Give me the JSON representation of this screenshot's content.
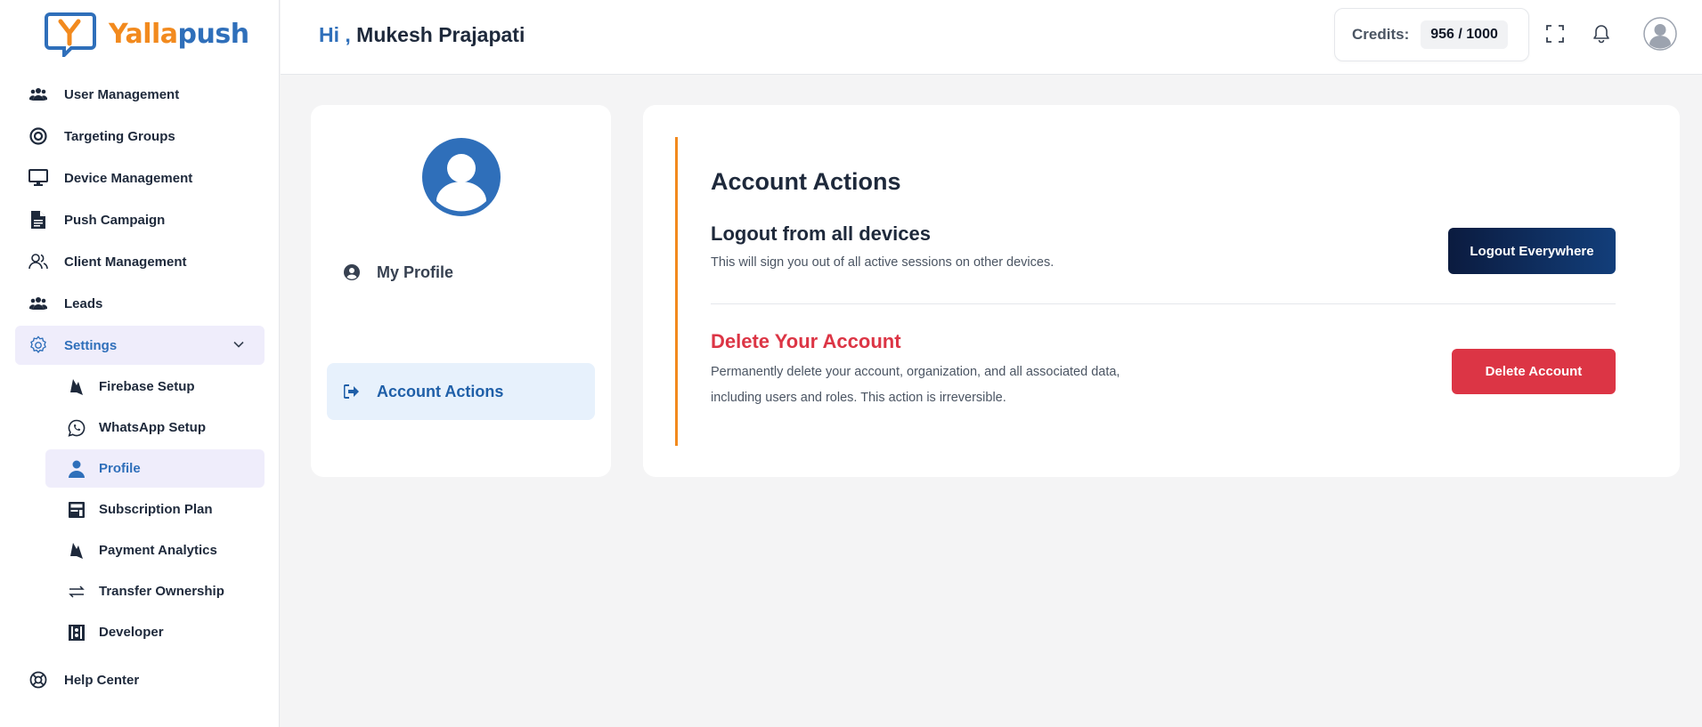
{
  "brand": {
    "name_part1": "Yalla",
    "name_part2": "push"
  },
  "header": {
    "greeting_hi": "Hi ,",
    "user_name": "Mukesh Prajapati",
    "credits_label": "Credits:",
    "credits_value": "956 / 1000"
  },
  "sidebar": {
    "items": [
      {
        "label": "User Management",
        "icon": "users-icon"
      },
      {
        "label": "Targeting Groups",
        "icon": "target-icon"
      },
      {
        "label": "Device Management",
        "icon": "monitor-icon"
      },
      {
        "label": "Push Campaign",
        "icon": "document-icon"
      },
      {
        "label": "Client Management",
        "icon": "user-group-outline-icon"
      },
      {
        "label": "Leads",
        "icon": "users-icon"
      },
      {
        "label": "Settings",
        "icon": "gear-icon"
      }
    ],
    "settings_sub": [
      {
        "label": "Firebase Setup",
        "icon": "firebase-icon"
      },
      {
        "label": "WhatsApp Setup",
        "icon": "whatsapp-icon"
      },
      {
        "label": "Profile",
        "icon": "person-icon"
      },
      {
        "label": "Subscription Plan",
        "icon": "subscription-icon"
      },
      {
        "label": "Payment Analytics",
        "icon": "firebase-icon"
      },
      {
        "label": "Transfer Ownership",
        "icon": "transfer-icon"
      },
      {
        "label": "Developer",
        "icon": "developer-icon"
      }
    ],
    "help": {
      "label": "Help Center",
      "icon": "lifebuoy-icon"
    }
  },
  "profile_tabs": {
    "my_profile": "My Profile",
    "account_actions": "Account Actions"
  },
  "account_actions": {
    "title": "Account Actions",
    "logout_title": "Logout from all devices",
    "logout_desc": "This will sign you out of all active sessions on other devices.",
    "logout_button": "Logout Everywhere",
    "delete_title": "Delete Your Account",
    "delete_desc_line1": "Permanently delete your account, organization, and all associated data,",
    "delete_desc_line2": "including users and roles. This action is irreversible.",
    "delete_button": "Delete Account"
  },
  "colors": {
    "brand_blue": "#2f6fba",
    "brand_orange": "#f28a1e",
    "danger": "#dc3545",
    "dark_button": "#0b1b3f"
  }
}
